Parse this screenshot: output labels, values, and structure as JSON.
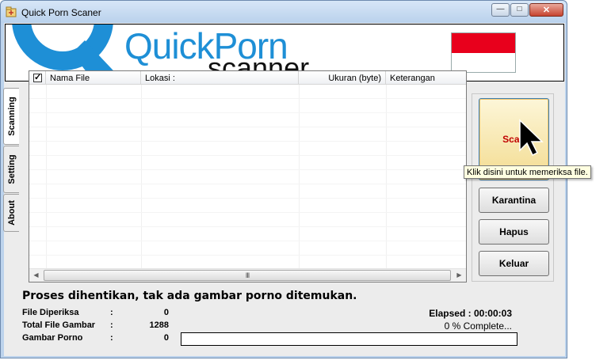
{
  "window": {
    "title": "Quick Porn Scaner",
    "minimize_glyph": "—",
    "maximize_glyph": "□",
    "close_glyph": "✕"
  },
  "banner": {
    "brand_quick": "Quick",
    "brand_porn": "Porn",
    "brand_scanner": "scanner",
    "brand_color": "#1e8fd6",
    "flag_top_color": "#e8001c",
    "flag_bottom_color": "#ffffff"
  },
  "tabs": [
    {
      "label": "Scanning",
      "active": true
    },
    {
      "label": "Setting",
      "active": false
    },
    {
      "label": "About",
      "active": false
    }
  ],
  "file_list": {
    "select_all_checked": true,
    "check_glyph": "✓",
    "columns": [
      "Nama File",
      "Lokasi :",
      "Ukuran (byte)",
      "Keterangan"
    ],
    "rows": [],
    "scroll_left_glyph": "◀",
    "scroll_right_glyph": "▶",
    "scroll_grip": "III"
  },
  "buttons": {
    "scan": "Scan",
    "quarantine": "Karantina",
    "delete": "Hapus",
    "exit": "Keluar"
  },
  "tooltip": "Klik disini untuk memeriksa file.",
  "status": {
    "message": "Proses dihentikan, tak ada gambar porno ditemukan.",
    "files_checked_label": "File Diperiksa",
    "files_checked_value": "0",
    "total_images_label": "Total File Gambar",
    "total_images_value": "1288",
    "porn_images_label": "Gambar Porno",
    "porn_images_value": "0",
    "colon": ":",
    "elapsed": "Elapsed : 00:00:03",
    "complete": "0 % Complete...",
    "progress_fraction": 0
  }
}
